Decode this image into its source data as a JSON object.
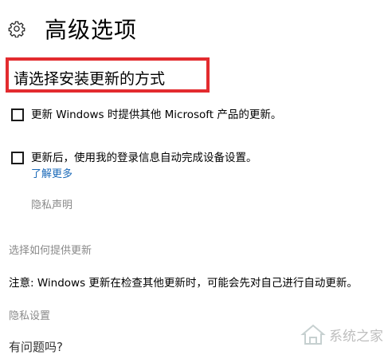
{
  "header": {
    "icon": "gear-icon",
    "title": "高级选项"
  },
  "section_heading": "请选择安装更新的方式",
  "options": [
    {
      "label": "更新 Windows 时提供其他 Microsoft 产品的更新。",
      "checked": false
    },
    {
      "label": "更新后，使用我的登录信息自动完成设备设置。",
      "checked": false
    }
  ],
  "learn_more": "了解更多",
  "privacy_statement": "隐私声明",
  "choose_delivery": "选择如何提供更新",
  "note": "注意: Windows 更新在检查其他更新时，可能会先对自己进行自动更新。",
  "privacy_settings": "隐私设置",
  "questions": "有问题吗?",
  "watermark": "系统之家",
  "colors": {
    "highlight_box": "#e32b2f",
    "link": "#1a69b8",
    "muted": "#7a7a7a"
  }
}
